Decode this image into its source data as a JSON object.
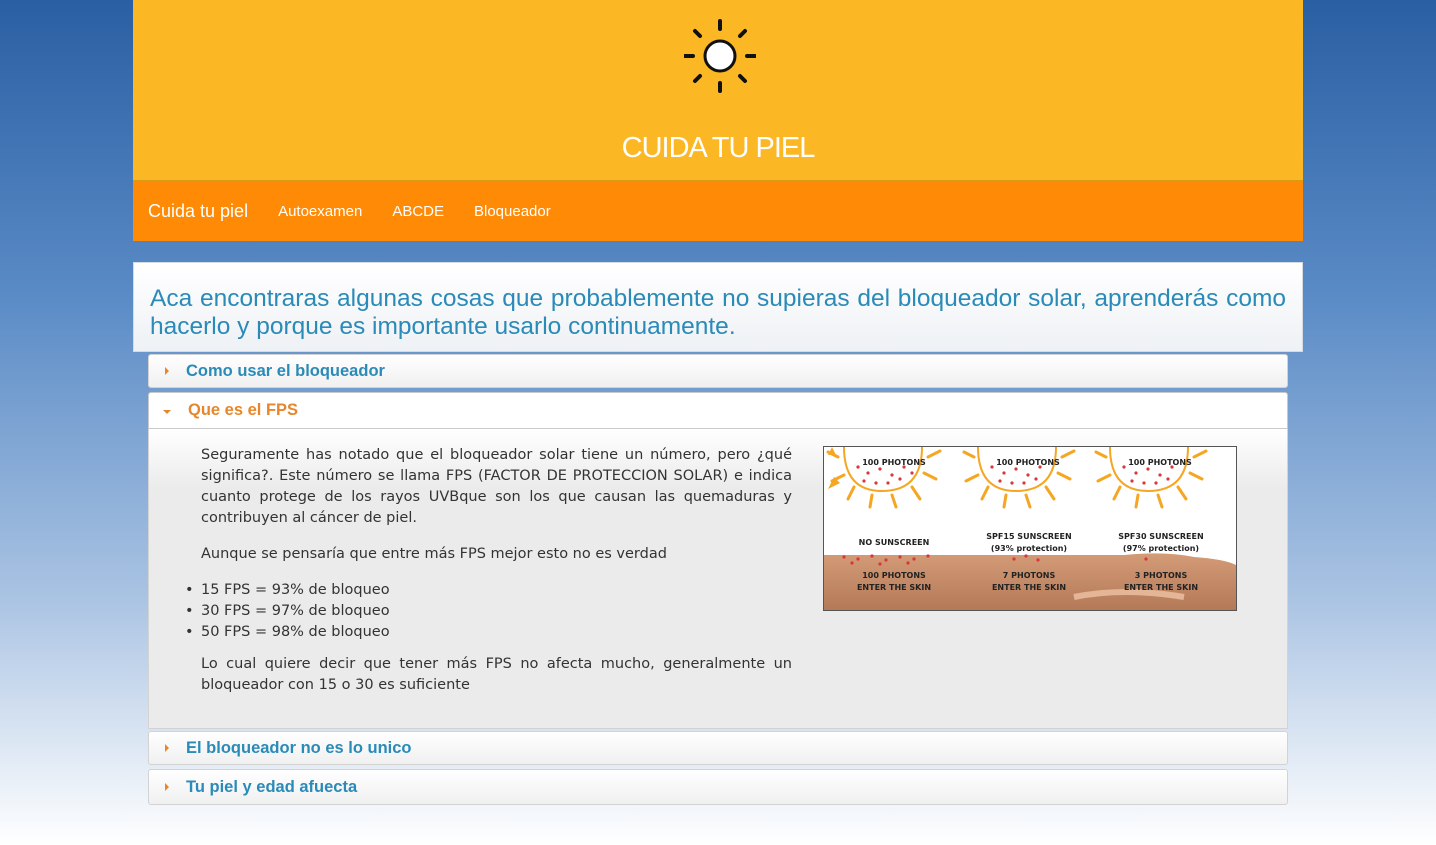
{
  "header": {
    "title": "CUIDA TU PIEL",
    "logo_icon": "sun-icon"
  },
  "navbar": {
    "brand": "Cuida tu piel",
    "links": [
      "Autoexamen",
      "ABCDE",
      "Bloqueador"
    ]
  },
  "intro": {
    "text": "Aca encontraras algunas cosas que probablemente no supieras del bloqueador solar, aprenderás como hacerlo y porque es importante usarlo continuamente."
  },
  "accordion": {
    "sections": [
      {
        "label": "Como usar el bloqueador",
        "expanded": false
      },
      {
        "label": "Que es el FPS",
        "expanded": true
      },
      {
        "label": "El bloqueador no es lo unico",
        "expanded": false
      },
      {
        "label": "Tu piel y edad afuecta",
        "expanded": false
      }
    ],
    "fps": {
      "p1": "Seguramente has notado que el bloqueador solar tiene un número, pero ¿qué significa?. Este número se llama FPS (FACTOR DE PROTECCION SOLAR) e indica cuanto protege de los rayos UVBque son los que causan las quemaduras y contribuyen al cáncer de piel.",
      "p2": "Aunque se pensaría que entre más FPS mejor esto no es verdad",
      "list": [
        "15 FPS = 93% de bloqueo",
        "30 FPS = 97% de bloqueo",
        "50 FPS = 98% de bloqueo"
      ],
      "p3": "Lo cual quiere decir que tener más FPS no afecta mucho, generalmente un bloqueador con 15 o 30 es suficiente"
    },
    "figure": {
      "panels": [
        {
          "top": "100 PHOTONS",
          "label": "NO SUNSCREEN",
          "sub": "",
          "bottom1": "100 PHOTONS",
          "bottom2": "ENTER THE SKIN"
        },
        {
          "top": "100 PHOTONS",
          "label": "SPF15 SUNSCREEN",
          "sub": "(93% protection)",
          "bottom1": "7 PHOTONS",
          "bottom2": "ENTER THE SKIN"
        },
        {
          "top": "100 PHOTONS",
          "label": "SPF30 SUNSCREEN",
          "sub": "(97% protection)",
          "bottom1": "3 PHOTONS",
          "bottom2": "ENTER THE SKIN"
        }
      ]
    }
  },
  "colors": {
    "header_bg": "#fcb725",
    "navbar_bg": "#ff8a06",
    "link_blue": "#2a8ab8",
    "accent_orange": "#e7862c"
  }
}
